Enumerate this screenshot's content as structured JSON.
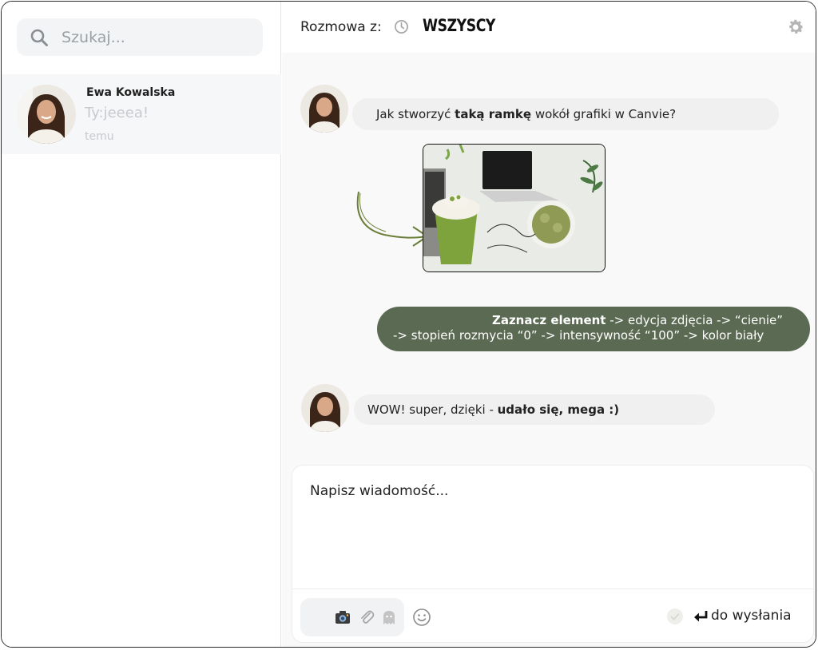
{
  "sidebar": {
    "search": {
      "placeholder": "Szukaj..."
    },
    "conversations": [
      {
        "name": "Ewa Kowalska",
        "preview": "Ty:jeeea!",
        "time": "temu"
      }
    ]
  },
  "chat": {
    "header_label": "Rozmowa z:",
    "header_target": "WSZYSCY",
    "messages": [
      {
        "direction": "in",
        "parts": [
          "Jak stworzyć ",
          "taką ramkę",
          " wokół grafiki w Canvie?"
        ]
      },
      {
        "direction": "out",
        "line1": {
          "bold": "Zaznacz element",
          "rest": " -> edycja zdjęcia -> “cienie”"
        },
        "line2": "-> stopień rozmycia “0” ->  intensywność “100” -> kolor biały"
      },
      {
        "direction": "in",
        "parts": [
          "WOW! super, dzięki - ",
          "udało się, mega :)"
        ]
      }
    ]
  },
  "composer": {
    "placeholder": "Napisz wiadomość...",
    "send_hint": "do wysłania"
  },
  "colors": {
    "accent_green": "#5b6a52",
    "bubble_in": "#f0f0f0",
    "sidebar_active": "#f6f7f9"
  },
  "icons": [
    "search-icon",
    "clock-icon",
    "gear-icon",
    "camera-icon",
    "paperclip-icon",
    "ghost-icon",
    "emoji-icon",
    "check-icon",
    "enter-key-icon"
  ]
}
